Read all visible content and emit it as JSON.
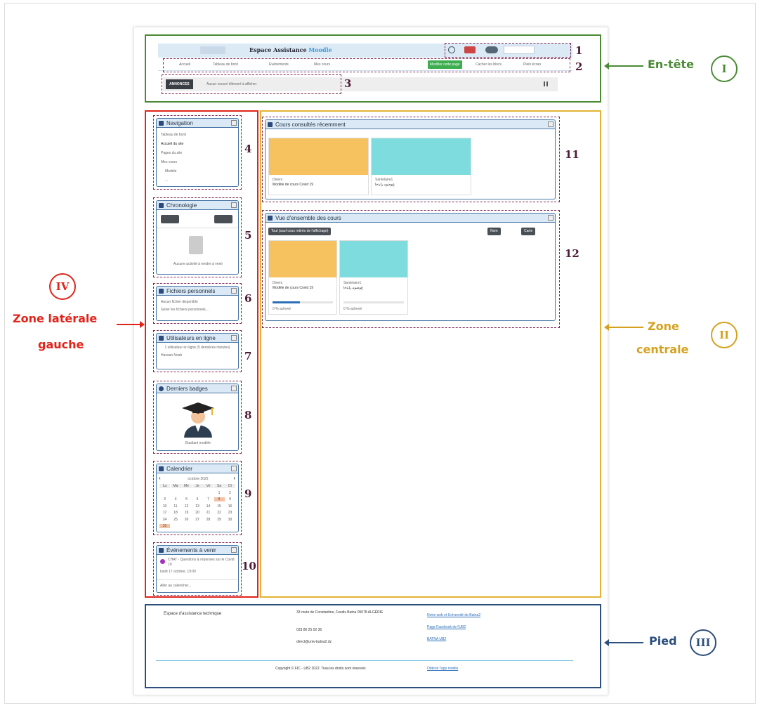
{
  "header": {
    "title_prefix": "Espace Assistance",
    "title_brand": "Moodle",
    "nav_items": [
      "Accueil",
      "Tableau de bord",
      "Événements",
      "Mes cours"
    ],
    "edit_button": "Modifier cette page",
    "hide_blocks": "Cacher les blocs",
    "fullscreen": "Plein écran",
    "announcement_badge": "ANNONCES",
    "announcement_text": "Aucun nouvel élément à afficher"
  },
  "blocks": {
    "navigation": {
      "title": "Navigation",
      "items": [
        "Tableau de bord",
        "Accueil du site",
        "Pages du site",
        "Mes cours",
        "Modèle",
        "..."
      ]
    },
    "chronologie": {
      "title": "Chronologie",
      "empty": "Aucune activité à rendre à venir"
    },
    "fichiers": {
      "title": "Fichiers personnels",
      "line1": "Aucun fichier disponible",
      "line2": "Gérer les fichiers personnels..."
    },
    "utilisateurs": {
      "title": "Utilisateurs en ligne",
      "line1": "1 utilisateur en ligne (5 dernières minutes)",
      "user": "Hassan Noah"
    },
    "badges": {
      "title": "Derniers badges",
      "caption": "Etudiant modèle"
    },
    "calendrier": {
      "title": "Calendrier",
      "month": "octobre 2022",
      "days": [
        "Lu",
        "Ma",
        "Me",
        "Je",
        "Ve",
        "Sa",
        "Di"
      ],
      "dates": [
        "",
        "",
        "",
        "",
        "",
        "1",
        "2",
        "3",
        "4",
        "5",
        "6",
        "7",
        "8",
        "9",
        "10",
        "11",
        "12",
        "13",
        "14",
        "15",
        "16",
        "17",
        "18",
        "19",
        "20",
        "21",
        "22",
        "23",
        "24",
        "25",
        "26",
        "27",
        "28",
        "29",
        "30",
        "31"
      ]
    },
    "evenements": {
      "title": "Événements à venir",
      "event": "CHAT - Questions & réponses sur le Covid 19",
      "date": "lundi 17 octobre, 19:00",
      "link": "Aller au calendrier..."
    },
    "cours_recents": {
      "title": "Cours consultés récemment",
      "courses": [
        {
          "cat": "Divers",
          "name": "Modèle de cours Covid 19"
        },
        {
          "cat": "Santelaire1",
          "name": "ﻉﻮﺿﻮﻣ ﺭﺎﺒﺘﺧﺍ"
        }
      ]
    },
    "vue_ensemble": {
      "title": "Vue d'ensemble des cours",
      "filter_button": "Tout (sauf ceux retirés de l'affichage)",
      "sort_button": "Nom",
      "view_button": "Carte",
      "courses": [
        {
          "cat": "Divers",
          "name": "Modèle de cours Covid 19",
          "progress": "0 % achevé",
          "progress_fraction": 0.45
        },
        {
          "cat": "Santelaire1",
          "name": "ﻉﻮﺿﻮﻣ ﺭﺎﺒﺘﺧﺍ",
          "progress": "0 % achevé",
          "progress_fraction": 0
        }
      ]
    }
  },
  "footer": {
    "title": "Espace d'assistance technique",
    "address": "33 route de Constantine, Fesdis Batna 05078 ALGÉRIE",
    "phone": "033 80 25 02 36",
    "email": "direct@univ-batna2.dz",
    "link1": "Notre web et Université de Batna2",
    "link2": "Page Facebook de l'UB2",
    "link3": "BATNA UB2",
    "copyright": "Copyright © FIC - UB2 2022. Tous les droits sont réservés",
    "mobile": "Obtenir l'app mobile"
  },
  "numbers": [
    "1",
    "2",
    "3",
    "4",
    "5",
    "6",
    "7",
    "8",
    "9",
    "10",
    "11",
    "12"
  ],
  "zones": {
    "entete": {
      "label": "En-tête",
      "roman": "I",
      "color": "#4a8a34"
    },
    "centrale": {
      "label1": "Zone",
      "label2": "centrale",
      "roman": "II",
      "color": "#d4a21f"
    },
    "pied": {
      "label": "Pied",
      "roman": "III",
      "color": "#2d4f7c"
    },
    "laterale": {
      "label1": "Zone latérale",
      "label2": "gauche",
      "roman": "IV",
      "color": "#e2231a"
    }
  }
}
